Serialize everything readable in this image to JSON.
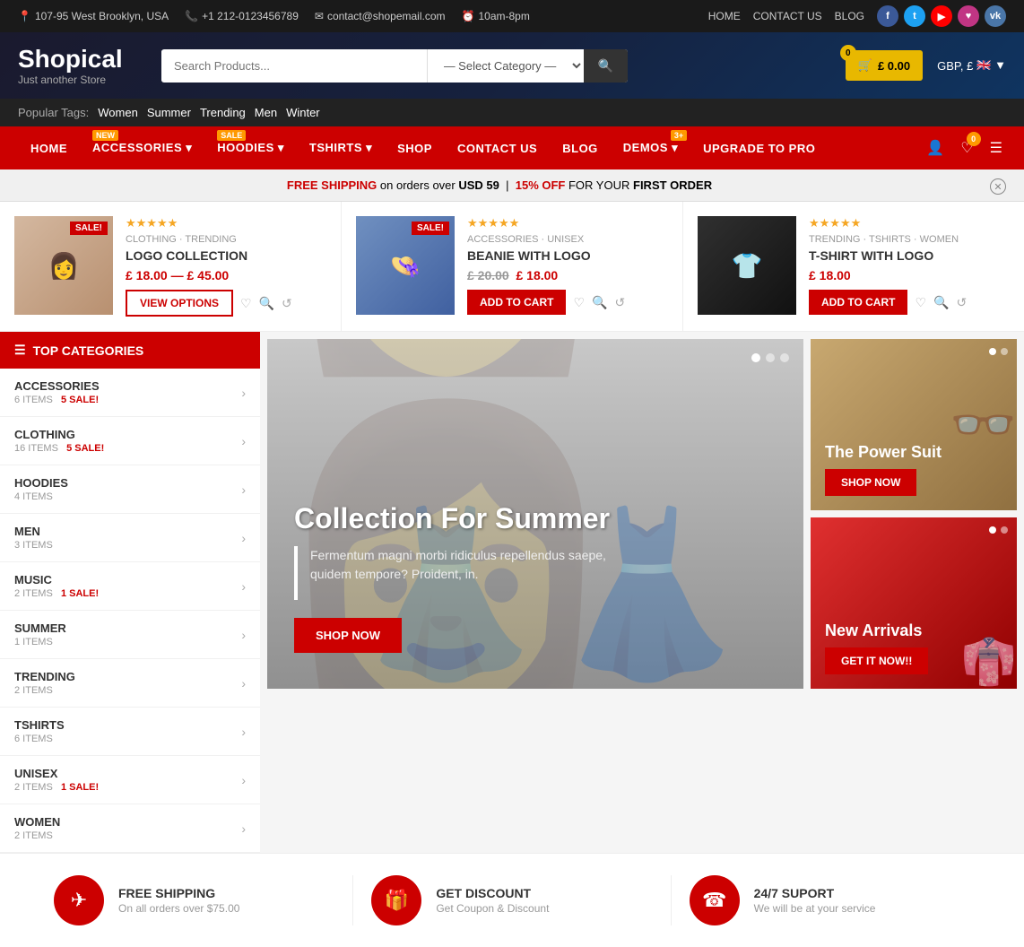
{
  "topbar": {
    "address": "107-95 West Brooklyn, USA",
    "phone": "+1 212-0123456789",
    "email": "contact@shopemail.com",
    "hours": "10am-8pm",
    "nav": [
      "HOME",
      "CONTACT US",
      "BLOG"
    ],
    "social": [
      "f",
      "t",
      "▶",
      "♥",
      "vk"
    ]
  },
  "header": {
    "logo_title": "Shopical",
    "logo_sub": "Just another Store",
    "search_placeholder": "Search Products...",
    "category_placeholder": "— Select Category —",
    "cart_badge": "0",
    "cart_price": "£ 0.00",
    "currency": "GBP, £"
  },
  "popular_tags": {
    "label": "Popular Tags:",
    "tags": [
      "Women",
      "Summer",
      "Trending",
      "Men",
      "Winter"
    ]
  },
  "nav": {
    "items": [
      {
        "label": "HOME",
        "badge": null,
        "has_dropdown": false
      },
      {
        "label": "ACCESSORIES",
        "badge": "NEW",
        "badge_type": "new",
        "has_dropdown": true
      },
      {
        "label": "HOODIES",
        "badge": "SALE",
        "badge_type": "sale",
        "has_dropdown": true
      },
      {
        "label": "TSHIRTS",
        "badge": null,
        "has_dropdown": true
      },
      {
        "label": "SHOP",
        "badge": null,
        "has_dropdown": false
      },
      {
        "label": "CONTACT US",
        "badge": null,
        "has_dropdown": false
      },
      {
        "label": "BLOG",
        "badge": null,
        "has_dropdown": false
      },
      {
        "label": "DEMOS",
        "badge": "3+",
        "badge_type": "num",
        "has_dropdown": true
      },
      {
        "label": "UPGRADE TO PRO",
        "badge": null,
        "has_dropdown": false
      }
    ],
    "wishlist_badge": "0"
  },
  "promo": {
    "text1": "FREE SHIPPING",
    "text2": "on orders over",
    "text3": "USD 59",
    "separator": "|",
    "text4": "15% OFF",
    "text5": "FOR YOUR",
    "text6": "FIRST ORDER"
  },
  "products": [
    {
      "category": "CLOTHING · TRENDING",
      "name": "LOGO COLLECTION",
      "price_from": "£ 18.00",
      "price_to": "£ 45.00",
      "sale": true,
      "rating": "★★★★★",
      "btn": "VIEW OPTIONS",
      "btn_type": "outline"
    },
    {
      "category": "ACCESSORIES · UNISEX",
      "name": "BEANIE WITH LOGO",
      "price_old": "£ 20.00",
      "price_new": "£ 18.00",
      "sale": true,
      "rating": "★★★★★",
      "btn": "ADD TO CART",
      "btn_type": "filled"
    },
    {
      "category": "TRENDING · TSHIRTS · WOMEN",
      "name": "T-SHIRT WITH LOGO",
      "price": "£ 18.00",
      "sale": false,
      "rating": "★★★★★",
      "btn": "ADD TO CART",
      "btn_type": "filled"
    }
  ],
  "sidebar": {
    "title": "TOP CATEGORIES",
    "categories": [
      {
        "name": "ACCESSORIES",
        "count": "6 ITEMS",
        "sale": "5 SALE!"
      },
      {
        "name": "CLOTHING",
        "count": "16 ITEMS",
        "sale": "5 SALE!"
      },
      {
        "name": "HOODIES",
        "count": "4 ITEMS",
        "sale": null
      },
      {
        "name": "MEN",
        "count": "3 ITEMS",
        "sale": null
      },
      {
        "name": "MUSIC",
        "count": "2 ITEMS",
        "sale": "1 SALE!"
      },
      {
        "name": "SUMMER",
        "count": "1 ITEMS",
        "sale": null
      },
      {
        "name": "TRENDING",
        "count": "2 ITEMS",
        "sale": null
      },
      {
        "name": "TSHIRTS",
        "count": "6 ITEMS",
        "sale": null
      },
      {
        "name": "UNISEX",
        "count": "2 ITEMS",
        "sale": "1 SALE!"
      },
      {
        "name": "WOMEN",
        "count": "2 ITEMS",
        "sale": null
      }
    ]
  },
  "hero": {
    "title": "Collection For Summer",
    "description": "Fermentum magni morbi ridiculus repellendus saepe, quidem tempore? Proident, in.",
    "btn": "SHOP NOW",
    "dots": 3
  },
  "side_banners": [
    {
      "title": "The Power Suit",
      "btn": "SHOP NOW",
      "dots": 2
    },
    {
      "title": "New Arrivals",
      "btn": "GET IT NOW!!",
      "dots": 2
    }
  ],
  "features": [
    {
      "icon": "✈",
      "title": "FREE SHIPPING",
      "desc": "On all orders over $75.00"
    },
    {
      "icon": "🎁",
      "title": "GET DISCOUNT",
      "desc": "Get Coupon & Discount"
    },
    {
      "icon": "☎",
      "title": "24/7 SUPORT",
      "desc": "We will be at your service"
    }
  ]
}
